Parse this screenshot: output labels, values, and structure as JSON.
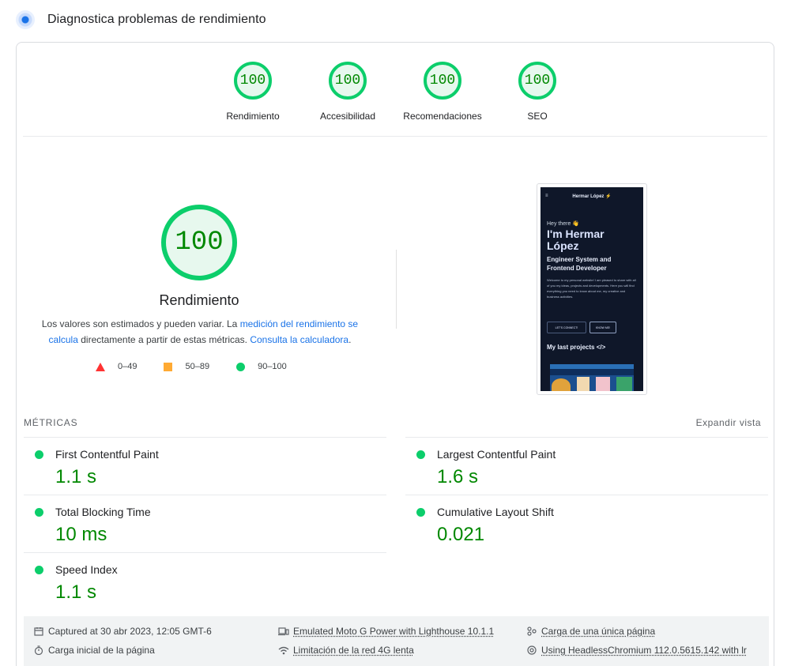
{
  "header": {
    "title": "Diagnostica problemas de rendimiento"
  },
  "scores": [
    {
      "value": "100",
      "label": "Rendimiento"
    },
    {
      "value": "100",
      "label": "Accesibilidad"
    },
    {
      "value": "100",
      "label": "Recomendaciones"
    },
    {
      "value": "100",
      "label": "SEO"
    }
  ],
  "main_score": {
    "value": "100",
    "label": "Rendimiento",
    "desc_1": "Los valores son estimados y pueden variar. La ",
    "desc_link_1": "medición del rendimiento se calcula",
    "desc_2": " directamente a partir de estas métricas. ",
    "desc_link_2": "Consulta la calculadora",
    "desc_3": "."
  },
  "legend": [
    {
      "range": "0–49",
      "color": "#ff3333"
    },
    {
      "range": "50–89",
      "color": "#ffaa33"
    },
    {
      "range": "90–100",
      "color": "#0cce6b"
    }
  ],
  "screenshot": {
    "menu": "≡",
    "name": "Hermar López ⚡",
    "greeting": "Hey there 👋",
    "title": "I'm Hermar López",
    "subtitle": "Engineer System and Frontend Developer",
    "body": "Welcome to my personal website! I am pleased to share with all of you my ideas, projects and developments. Here you will find everything you need to know about me, my creative and business activities.",
    "btn_connect": "LET'S CONNECT!",
    "btn_know": "KNOW ME!",
    "projects": "My last projects </>"
  },
  "metrics": {
    "title": "MÉTRICAS",
    "expand": "Expandir vista",
    "items": [
      {
        "name": "First Contentful Paint",
        "value": "1.1 s"
      },
      {
        "name": "Largest Contentful Paint",
        "value": "1.6 s"
      },
      {
        "name": "Total Blocking Time",
        "value": "10 ms"
      },
      {
        "name": "Cumulative Layout Shift",
        "value": "0.021"
      },
      {
        "name": "Speed Index",
        "value": "1.1 s"
      }
    ]
  },
  "footer": {
    "captured": "Captured at 30 abr 2023, 12:05 GMT-6",
    "device": "Emulated Moto G Power with Lighthouse 10.1.1",
    "single_page": "Carga de una única página",
    "initial_load": "Carga inicial de la página",
    "throttling": "Limitación de la red 4G lenta",
    "browser": "Using HeadlessChromium 112.0.5615.142 with lr"
  },
  "colors": {
    "pass": "#0cce6b",
    "pass_text": "#008800",
    "link": "#1a73e8"
  }
}
